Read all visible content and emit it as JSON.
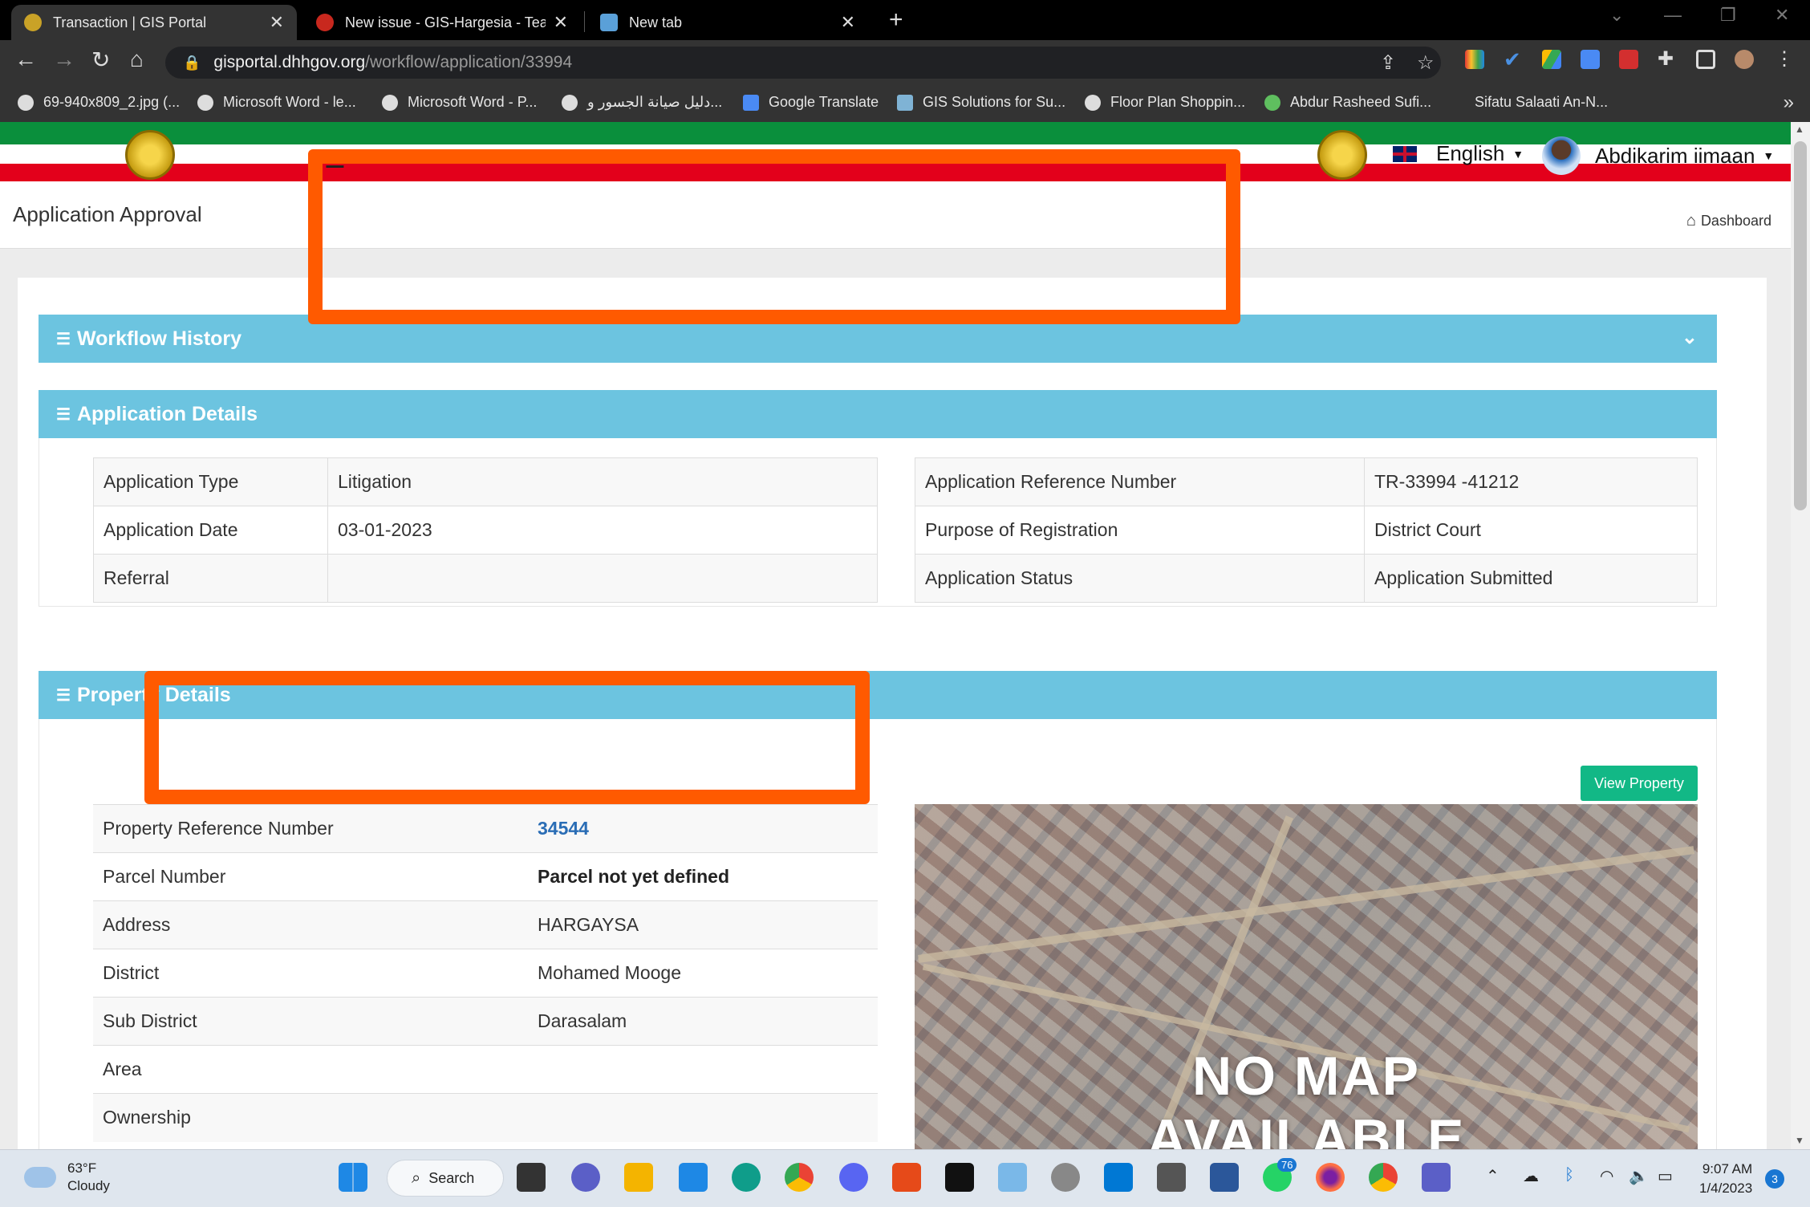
{
  "browser": {
    "tabs": [
      {
        "title": "Transaction | GIS Portal",
        "active": true
      },
      {
        "title": "New issue - GIS-Hargesia - Team",
        "active": false
      },
      {
        "title": "New tab",
        "active": false
      }
    ],
    "url_host": "gisportal.dhhgov.org",
    "url_path": "/workflow/application/33994",
    "bookmarks": [
      "69-940x809_2.jpg (...",
      "Microsoft Word - le...",
      "Microsoft Word - P...",
      "دليل صيانة الجسور و...",
      "Google Translate",
      "GIS Solutions for Su...",
      "Floor Plan Shoppin...",
      "Abdur Rasheed Sufi...",
      "Sifatu Salaati An-N..."
    ]
  },
  "header": {
    "language": "English",
    "user_name": "Abdikarim iimaan"
  },
  "page": {
    "title": "Application Approval",
    "breadcrumb": "Dashboard"
  },
  "sections": {
    "workflow_history": "Workflow History",
    "application_details": "Application Details",
    "property_details": "Property Details"
  },
  "application_details": {
    "left": [
      {
        "label": "Application Type",
        "value": "Litigation"
      },
      {
        "label": "Application Date",
        "value": "03-01-2023"
      },
      {
        "label": "Referral",
        "value": ""
      }
    ],
    "right": [
      {
        "label": "Application Reference Number",
        "value": "TR-33994 -41212"
      },
      {
        "label": "Purpose of Registration",
        "value": "District Court"
      },
      {
        "label": "Application Status",
        "value": "Application Submitted"
      }
    ]
  },
  "property_details": {
    "view_button": "View Property",
    "rows": [
      {
        "label": "Property Reference Number",
        "value": "34544"
      },
      {
        "label": "Parcel Number",
        "value": "Parcel not yet defined"
      },
      {
        "label": "Address",
        "value": "HARGAYSA"
      },
      {
        "label": "District",
        "value": "Mohamed Mooge"
      },
      {
        "label": "Sub District",
        "value": "Darasalam"
      },
      {
        "label": "Area",
        "value": ""
      },
      {
        "label": "Ownership",
        "value": ""
      }
    ],
    "map_text_line1": "NO MAP",
    "map_text_line2": "AVAILABLE"
  },
  "taskbar": {
    "temperature": "63°F",
    "condition": "Cloudy",
    "search_label": "Search",
    "whatsapp_badge": "76",
    "time": "9:07 AM",
    "date": "1/4/2023",
    "notifications": "3"
  },
  "colors": {
    "section_header": "#6cc4e0",
    "button_green": "#12b886",
    "flag_green": "#0a8f3c",
    "flag_red": "#e3001b",
    "redaction": "#ff5a00"
  }
}
